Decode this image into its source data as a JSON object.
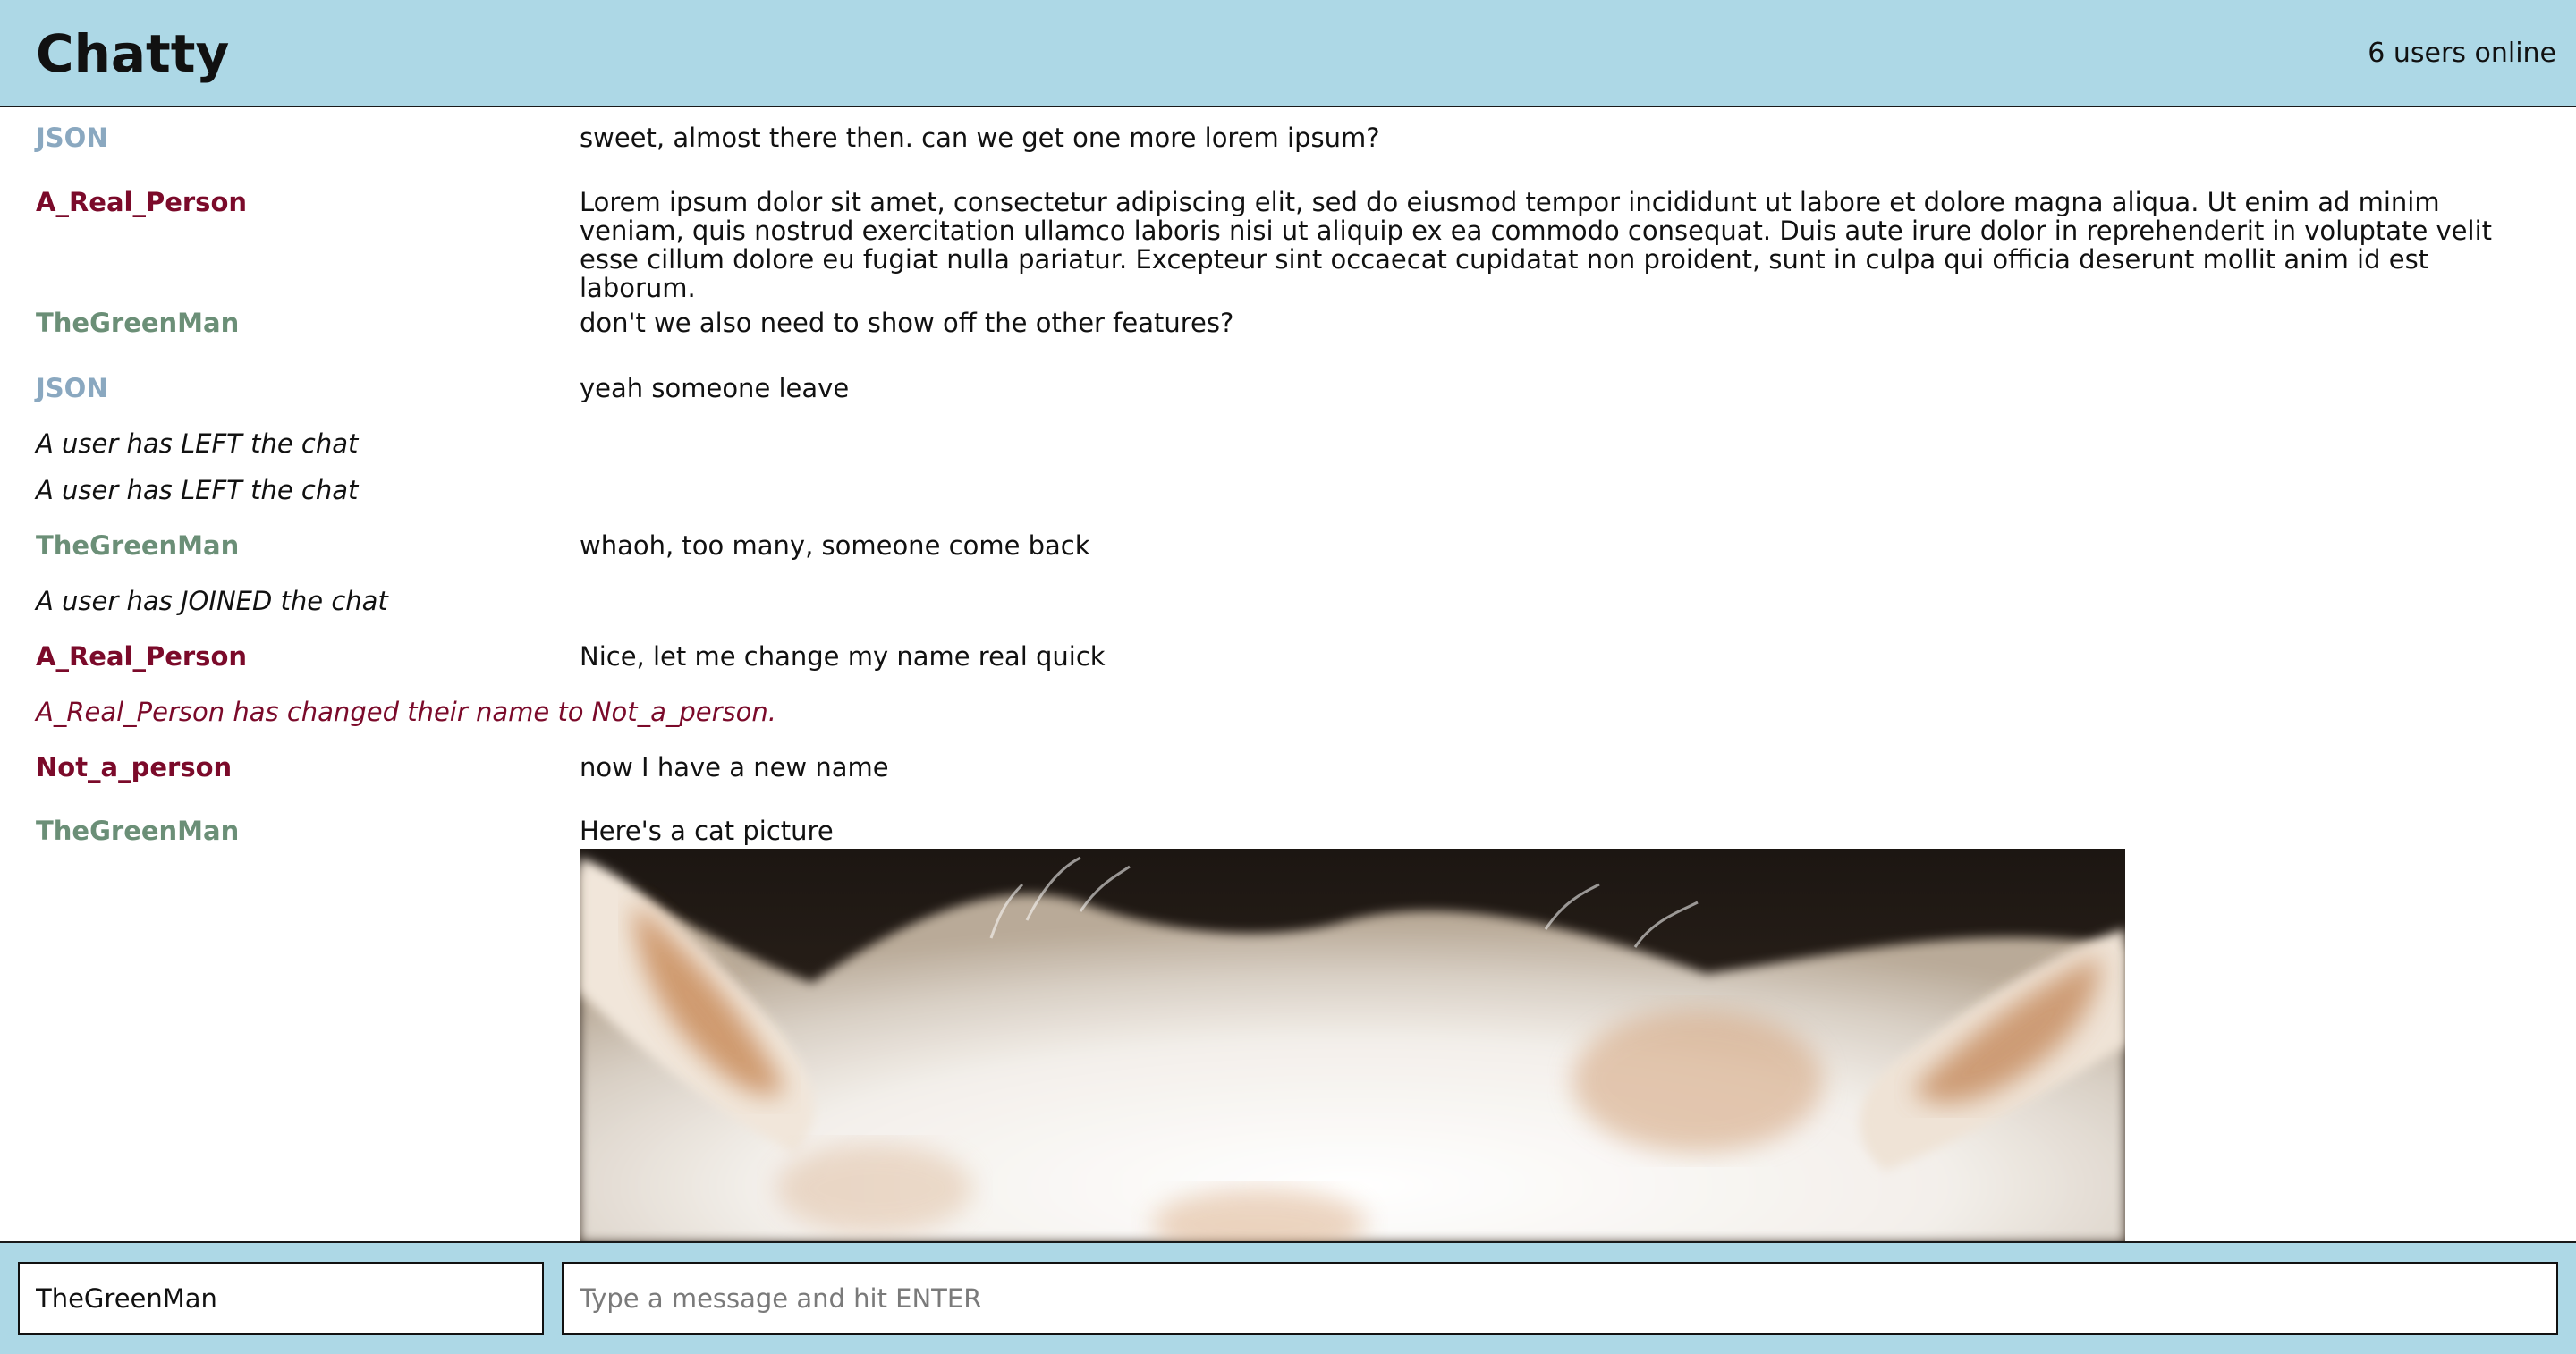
{
  "app": {
    "title": "Chatty",
    "users_online": "6 users online"
  },
  "colors": {
    "header_bg": "#add8e6",
    "json_color": "#8aa8c0",
    "real_person_color": "#7b0a2a",
    "green_man_color": "#6b8f77",
    "event_color": "#111111",
    "name_change_color": "#7b0a2a"
  },
  "messages": [
    {
      "sender": "JSON",
      "text": "sweet, almost there then. can we get one more lorem ipsum?"
    },
    {
      "sender": "A_Real_Person",
      "text": "Lorem ipsum dolor sit amet, consectetur adipiscing elit, sed do eiusmod tempor incididunt ut labore et dolore magna aliqua. Ut enim ad minim veniam, quis nostrud exercitation ullamco laboris nisi ut aliquip ex ea commodo consequat. Duis aute irure dolor in reprehenderit in voluptate velit esse cillum dolore eu fugiat nulla pariatur. Excepteur sint occaecat cupidatat non proident, sunt in culpa qui officia deserunt mollit anim id est laborum."
    },
    {
      "sender": "TheGreenMan",
      "text": "don't we also need to show off the other features?"
    },
    {
      "sender": "JSON",
      "text": "yeah someone leave"
    },
    {
      "event": "A user has LEFT the chat"
    },
    {
      "event": "A user has LEFT the chat"
    },
    {
      "sender": "TheGreenMan",
      "text": "whaoh, too many, someone come back"
    },
    {
      "event": "A user has JOINED the chat"
    },
    {
      "sender": "A_Real_Person",
      "text": "Nice, let me change my name real quick"
    },
    {
      "event": "A_Real_Person has changed their name to Not_a_person."
    },
    {
      "sender": "Not_a_person",
      "text": "now I have a new name"
    },
    {
      "sender": "TheGreenMan",
      "text": "Here's a cat picture",
      "image": "cat-photo"
    }
  ],
  "composer": {
    "name_value": "TheGreenMan",
    "message_placeholder": "Type a message and hit ENTER"
  }
}
